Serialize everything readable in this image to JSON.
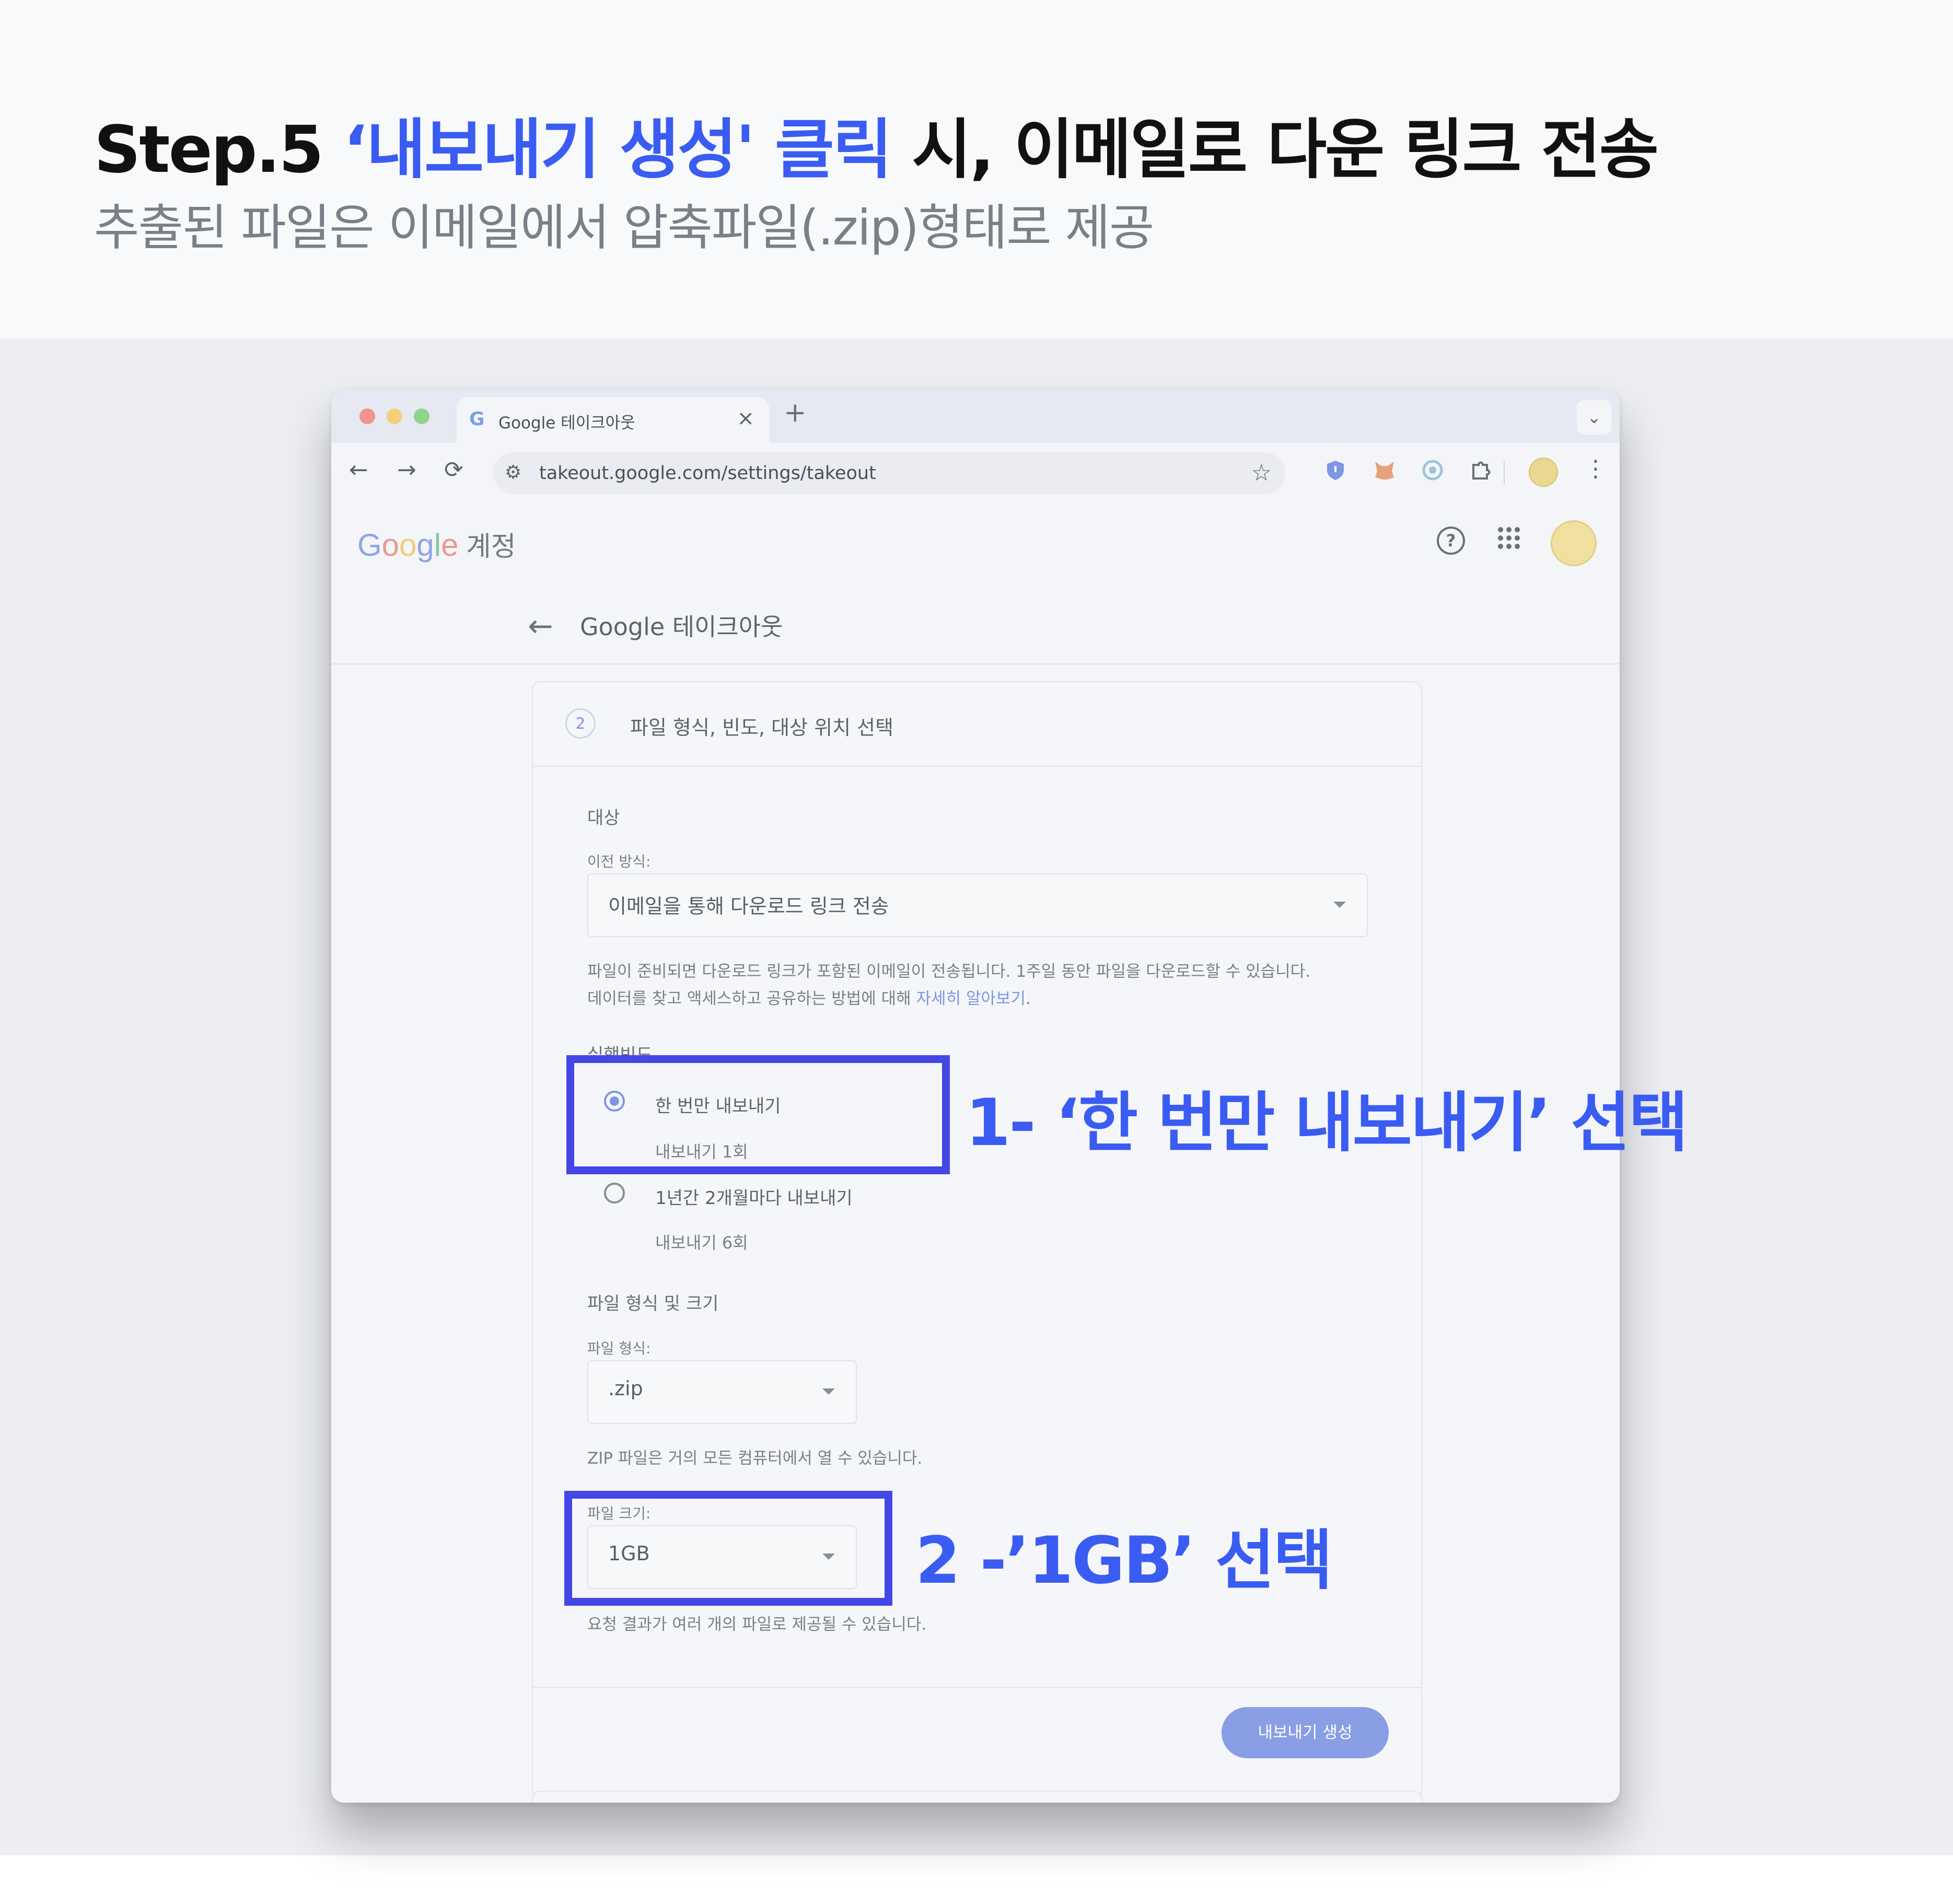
{
  "hero": {
    "step": "Step.5 ",
    "highlight": "‘내보내기 생성' 클릭",
    "rest": " 시, 이메일로 다운 링크 전송",
    "subtitle": "추출된 파일은 이메일에서 압축파일(.zip)형태로 제공"
  },
  "browser": {
    "tab_favicon": "G",
    "tab_title": "Google 테이크아웃",
    "tab_close": "×",
    "new_tab": "+",
    "tab_menu": "⌄",
    "back": "←",
    "forward": "→",
    "reload": "⟳",
    "site_settings": "⚙",
    "url": "takeout.google.com/settings/takeout",
    "bookmark": "☆",
    "menu": "⋮",
    "extensions": [
      {
        "name": "shield-extension-icon",
        "color": "#7d96e6"
      },
      {
        "name": "fox-extension-icon",
        "color": "#e6a27a"
      },
      {
        "name": "spiral-extension-icon",
        "color": "#9cc4dc"
      },
      {
        "name": "puzzle-extension-icon",
        "color": "#8a8d93"
      }
    ]
  },
  "account_header": {
    "logo_letters": [
      {
        "ch": "G",
        "color": "#8fa6e6"
      },
      {
        "ch": "o",
        "color": "#e79a92"
      },
      {
        "ch": "o",
        "color": "#f1cc78"
      },
      {
        "ch": "g",
        "color": "#8fa6e6"
      },
      {
        "ch": "l",
        "color": "#8cc79a"
      },
      {
        "ch": "e",
        "color": "#e79a92"
      }
    ],
    "label": " 계정",
    "help": "?",
    "apps": "⠿",
    "back_arrow": "←",
    "page_title": "Google 테이크아웃"
  },
  "card": {
    "step_number": "2",
    "step_title": "파일 형식, 빈도, 대상 위치 선택",
    "destination_heading": "대상",
    "transfer_label": "이전 방식:",
    "transfer_value": "이메일을 통해 다운로드 링크 전송",
    "transfer_help_1": "파일이 준비되면 다운로드 링크가 포함된 이메일이 전송됩니다. 1주일 동안 파일을 다운로드할 수 있습니다.",
    "transfer_help_2": "데이터를 찾고 액세스하고 공유하는 방법에 대해 ",
    "learn_more": "자세히 알아보기",
    "learn_more_suffix": ".",
    "frequency_heading": "실행빈도",
    "option1": "한 번만 내보내기",
    "option1_sub": "내보내기 1회",
    "option1_selected": true,
    "option2": "1년간 2개월마다 내보내기",
    "option2_sub": "내보내기 6회",
    "file_heading": "파일 형식 및 크기",
    "type_label": "파일 형식:",
    "type_value": ".zip",
    "type_help": "ZIP 파일은 거의 모든 컴퓨터에서 열 수 있습니다.",
    "size_label": "파일 크기:",
    "size_value": "1GB",
    "size_help": "요청 결과가 여러 개의 파일로 제공될 수 있습니다.",
    "export_button": "내보내기 생성"
  },
  "annotations": {
    "a1": "1- ‘한 번만 내보내기’ 선택",
    "a2": "2 -’1GB’ 선택"
  },
  "colors": {
    "accent": "#3a5cf3",
    "highlight_box": "#4446e6",
    "button": "#8a9ee6"
  }
}
